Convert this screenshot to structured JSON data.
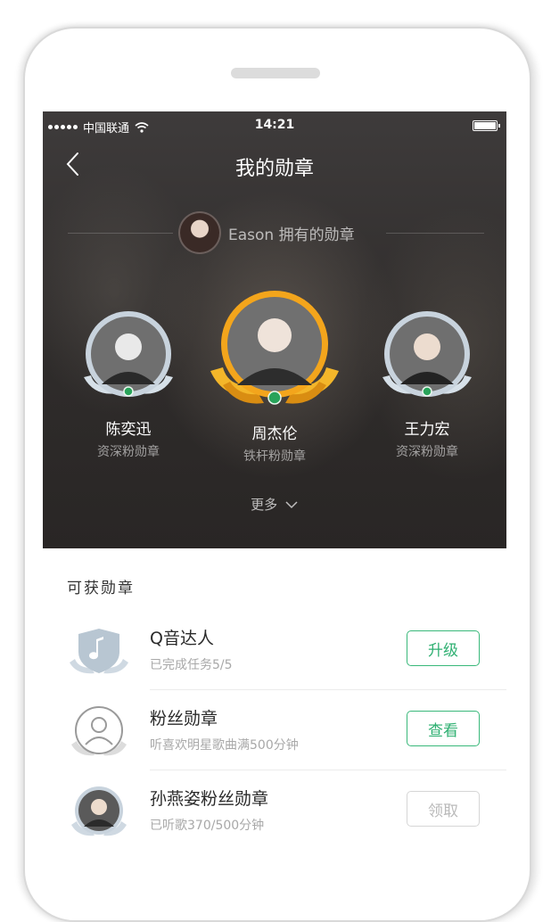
{
  "status_bar": {
    "carrier": "中国联通",
    "time": "14:21"
  },
  "header": {
    "title": "我的勋章",
    "owner_text": "Eason 拥有的勋章"
  },
  "badges": [
    {
      "name": "陈奕迅",
      "level": "资深粉勋章"
    },
    {
      "name": "周杰伦",
      "level": "铁杆粉勋章"
    },
    {
      "name": "王力宏",
      "level": "资深粉勋章"
    }
  ],
  "more_label": "更多",
  "available": {
    "title": "可获勋章",
    "items": [
      {
        "title": "Q音达人",
        "subtitle": "已完成任务5/5",
        "button": "升级",
        "button_state": "active"
      },
      {
        "title": "粉丝勋章",
        "subtitle": "听喜欢明星歌曲满500分钟",
        "button": "查看",
        "button_state": "active"
      },
      {
        "title": "孙燕姿粉丝勋章",
        "subtitle": "已听歌370/500分钟",
        "button": "领取",
        "button_state": "disabled"
      }
    ]
  },
  "colors": {
    "accent_green": "#2fb072",
    "gold_ring": "#f3a51c",
    "silver_ring": "#c8d3dd"
  }
}
